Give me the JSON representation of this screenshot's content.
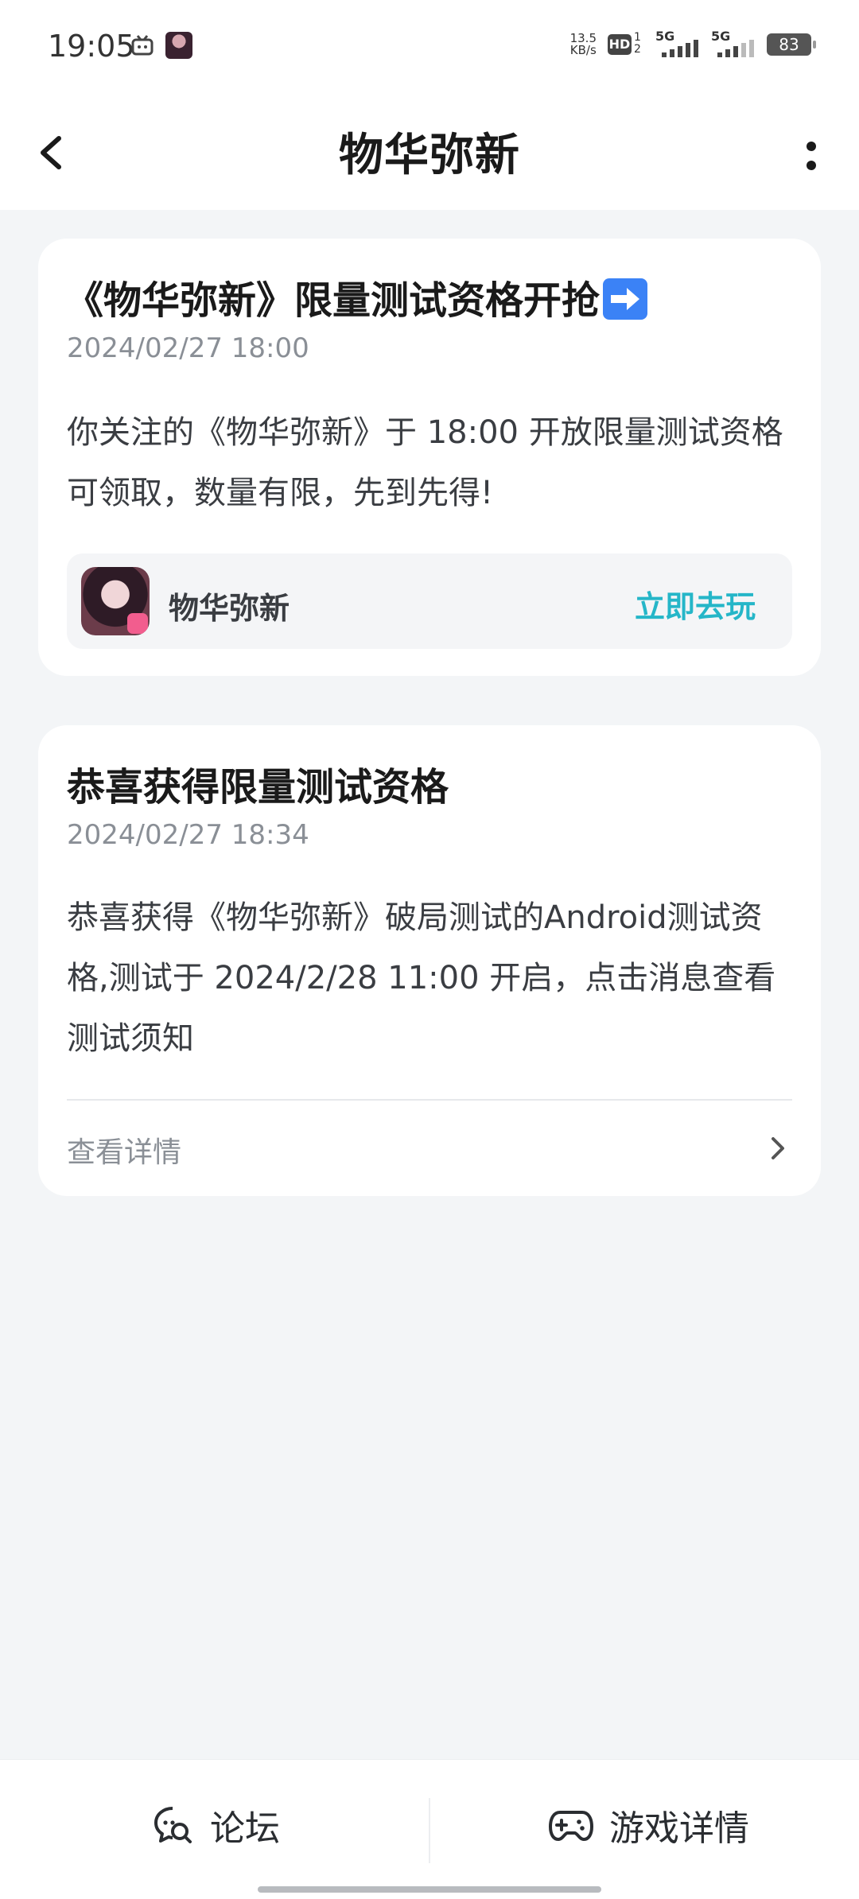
{
  "status_bar": {
    "time": "19:05",
    "net_speed_value": "13.5",
    "net_speed_unit": "KB/s",
    "hd_label": "HD",
    "sim1": "1",
    "sim2": "2",
    "sig1": "5G",
    "sig2": "5G",
    "battery": "83"
  },
  "header": {
    "title": "物华弥新",
    "back_icon": "chevron-left-icon",
    "more_icon": "more-vertical-icon"
  },
  "messages": [
    {
      "title": "《物华弥新》限量测试资格开抢",
      "title_emoji": "right-arrow-emoji",
      "time": "2024/02/27 18:00",
      "body": "你关注的《物华弥新》于 18:00 开放限量测试资格可领取，数量有限，先到先得!",
      "game": {
        "name": "物华弥新",
        "action_label": "立即去玩"
      }
    },
    {
      "title": "恭喜获得限量测试资格",
      "time": "2024/02/27 18:34",
      "body": "恭喜获得《物华弥新》破局测试的Android测试资格,测试于 2024/2/28 11:00 开启，点击消息查看测试须知",
      "link_label": "查看详情"
    }
  ],
  "bottom_bar": {
    "forum_label": "论坛",
    "game_detail_label": "游戏详情"
  },
  "colors": {
    "accent": "#25b6c8",
    "background": "#f3f5f7",
    "card": "#ffffff"
  }
}
